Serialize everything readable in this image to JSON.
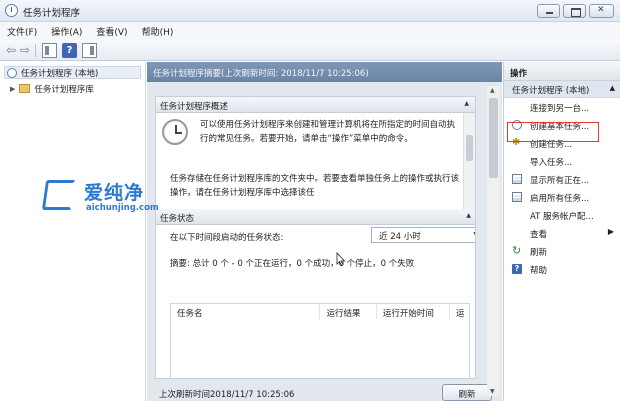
{
  "window": {
    "title": "任务计划程序"
  },
  "menu": [
    "文件(F)",
    "操作(A)",
    "查看(V)",
    "帮助(H)"
  ],
  "toolbar": {
    "icons": [
      "back-arrow-icon",
      "forward-arrow-icon",
      "show-hide-tree-icon",
      "help-icon",
      "show-hide-action-pane-icon"
    ]
  },
  "tree": {
    "root": "任务计划程序 (本地)",
    "child": "任务计划程序库"
  },
  "center": {
    "header": "任务计划程序摘要(上次刷新时间: 2018/11/7 10:25:06)",
    "overview": {
      "title": "任务计划程序概述",
      "para1": "可以使用任务计划程序来创建和管理计算机将在所指定的时间自动执行的常见任务。若要开始，请单击“操作”菜单中的命令。",
      "para2": "任务存储在任务计划程序库的文件夹中。若要查看单独任务上的操作或执行该操作，请在任务计划程序库中选择该任"
    },
    "status": {
      "title": "任务状态",
      "label": "在以下时间段启动的任务状态:",
      "dropdown_value": "近 24 小时",
      "summary": "摘要: 总计 0 个 - 0 个正在运行，0 个成功，0 个停止，0 个失败"
    },
    "table": {
      "columns": [
        "任务名",
        "运行结果",
        "运行开始时间",
        "运"
      ]
    },
    "footer": {
      "last_refresh": "上次刷新时间2018/11/7 10:25:06",
      "refresh_button": "刷新"
    }
  },
  "actions": {
    "header": "操作",
    "subheader": "任务计划程序 (本地)",
    "items": [
      {
        "label": "连接到另一台...",
        "icon": ""
      },
      {
        "label": "创建基本任务...",
        "icon": "clock-task-icon"
      },
      {
        "label": "创建任务...",
        "icon": "gear-task-icon"
      },
      {
        "label": "导入任务...",
        "icon": ""
      },
      {
        "label": "显示所有正在...",
        "icon": "list-icon"
      },
      {
        "label": "启用所有任务...",
        "icon": "list-icon"
      },
      {
        "label": "AT 服务帐户配...",
        "icon": ""
      },
      {
        "label": "查看",
        "icon": ""
      },
      {
        "label": "刷新",
        "icon": "refresh-icon"
      },
      {
        "label": "帮助",
        "icon": "help-icon"
      }
    ]
  },
  "watermark": {
    "text": "爱纯净",
    "url": "aichunjing.com"
  },
  "colors": {
    "highlight": "#e03a3a",
    "header_blue": "#6c84a4",
    "watermark": "#2b7bd0"
  }
}
